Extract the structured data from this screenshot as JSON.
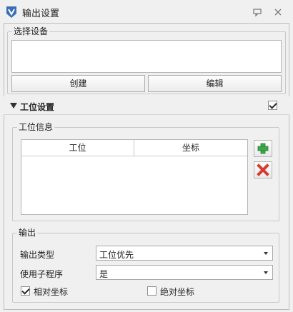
{
  "window": {
    "title": "输出设置",
    "icons": {
      "app": "app-logo-icon",
      "pin": "pin-icon",
      "close": "close-icon"
    }
  },
  "select_device": {
    "title": "选择设备",
    "create_label": "创建",
    "edit_label": "编辑"
  },
  "station_settings": {
    "title": "工位设置",
    "enabled": true,
    "info": {
      "title": "工位信息",
      "columns": [
        "工位",
        "坐标"
      ],
      "rows": [],
      "add_icon": "add-icon",
      "delete_icon": "delete-icon"
    }
  },
  "output": {
    "title": "输出",
    "type_label": "输出类型",
    "type_value": "工位优先",
    "subprogram_label": "使用子程序",
    "subprogram_value": "是",
    "relative_label": "相对坐标",
    "relative_checked": true,
    "absolute_label": "绝对坐标",
    "absolute_checked": false
  },
  "colors": {
    "add": "#3aa84a",
    "delete": "#d83a2e",
    "border": "#b7b7b7"
  }
}
